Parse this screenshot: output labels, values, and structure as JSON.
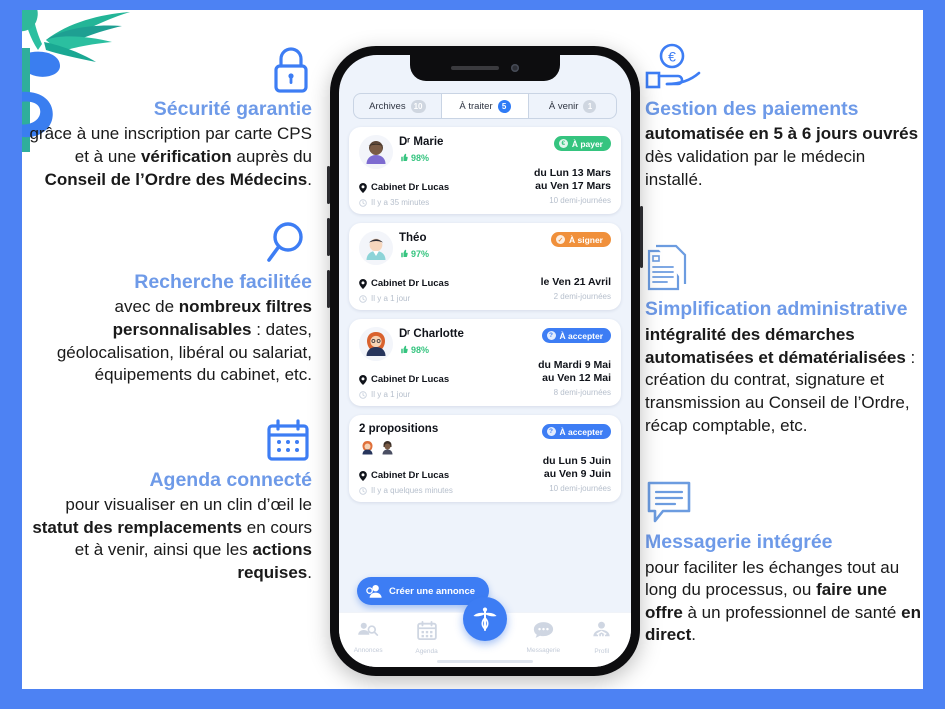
{
  "theme": {
    "page_bg": "#4d82f3",
    "card_bg": "#ffffff",
    "title_blue": "#6e9ae8",
    "accent_blue": "#3d7df4",
    "green": "#35c47f",
    "orange": "#f0903b",
    "badge_blue": "#3d7df4"
  },
  "left_column": [
    {
      "icon": "lock-icon",
      "title": "Sécurité garantie",
      "body_html": "grâce à une inscription par carte CPS et à une <b>vérification</b> auprès du <b>Conseil de l’Ordre des Médecins</b>."
    },
    {
      "icon": "search-icon",
      "title": "Recherche facilitée",
      "body_html": "avec de <b>nombreux filtres personnalisables</b> : dates, géolocalisation, libéral ou salariat, équipements du cabinet, etc."
    },
    {
      "icon": "calendar-icon",
      "title": "Agenda connecté",
      "body_html": "pour visualiser en un clin d’œil le <b>statut des remplacements</b> en cours et à venir, ainsi que les <b>actions requises</b>."
    }
  ],
  "right_column": [
    {
      "icon": "hand-euro-icon",
      "title": "Gestion des paiements",
      "body_html": "<b>automatisée en 5 à 6 jours ouvrés</b> dès validation par le médecin installé."
    },
    {
      "icon": "documents-icon",
      "title": "Simplification administrative",
      "body_html": "<b>intégralité des démarches automatisées et dématérialisées</b> : création du contrat, signature et transmission au Conseil de l’Ordre, récap comptable, etc."
    },
    {
      "icon": "chat-bubble-icon",
      "title": "Messagerie intégrée",
      "body_html": "pour faciliter les échanges tout au long du processus, ou <b>faire une offre</b> à un professionnel de santé <b>en direct</b>."
    }
  ],
  "phone": {
    "tabs": [
      {
        "label": "Archives",
        "badge": "10",
        "active": false
      },
      {
        "label": "À traiter",
        "badge": "5",
        "active": true
      },
      {
        "label": "À venir",
        "badge": "1",
        "active": false
      }
    ],
    "cards": [
      {
        "name": "Dʳ Marie",
        "rating": "98%",
        "badge_label": "À payer",
        "badge_color": "#35c47f",
        "badge_glyph": "€",
        "place": "Cabinet Dr Lucas",
        "time_ago": "Il y a 35 minutes",
        "date_line1": "du Lun 13 Mars",
        "date_line2": "au Ven 17 Mars",
        "duration": "10 demi-journées",
        "avatar_type": "single"
      },
      {
        "name": "Théo",
        "rating": "97%",
        "badge_label": "À signer",
        "badge_color": "#f0903b",
        "badge_glyph": "✓",
        "place": "Cabinet Dr Lucas",
        "time_ago": "Il y a 1 jour",
        "date_line1": "le Ven 21 Avril",
        "date_line2": "",
        "duration": "2 demi-journées",
        "avatar_type": "single"
      },
      {
        "name": "Dʳ Charlotte",
        "rating": "98%",
        "badge_label": "À accepter",
        "badge_color": "#3d7df4",
        "badge_glyph": "?",
        "place": "Cabinet Dr Lucas",
        "time_ago": "Il y a 1 jour",
        "date_line1": "du Mardi 9 Mai",
        "date_line2": "au Ven 12 Mai",
        "duration": "8 demi-journées",
        "avatar_type": "single"
      },
      {
        "name": "2 propositions",
        "rating": "",
        "badge_label": "À accepter",
        "badge_color": "#3d7df4",
        "badge_glyph": "?",
        "place": "Cabinet Dr Lucas",
        "time_ago": "Il y a quelques minutes",
        "date_line1": "du Lun 5 Juin",
        "date_line2": "au Ven 9 Juin",
        "duration": "10 demi-journées",
        "avatar_type": "duo"
      }
    ],
    "cta_label": "Créer une annonce",
    "nav": [
      {
        "label": "Annonces",
        "icon": "annonces-icon"
      },
      {
        "label": "Agenda",
        "icon": "calendar-nav-icon"
      },
      {
        "label": "Messagerie",
        "icon": "chat-nav-icon"
      },
      {
        "label": "Profil",
        "icon": "profile-nav-icon"
      }
    ],
    "fab_icon": "caduceus-icon"
  }
}
